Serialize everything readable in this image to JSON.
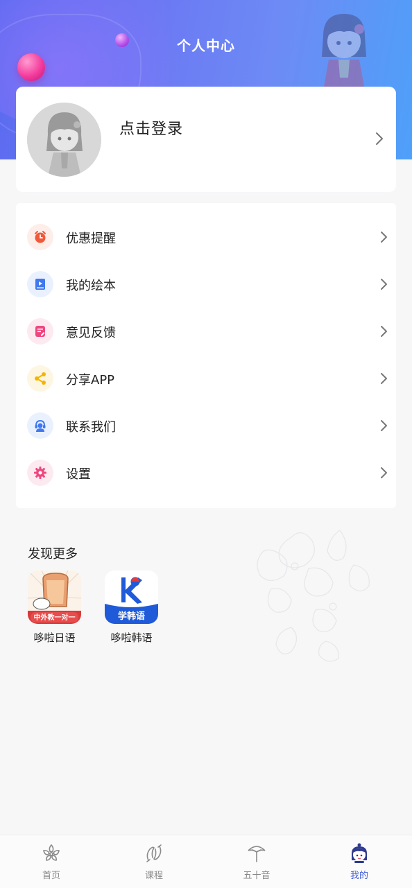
{
  "header": {
    "title": "个人中心"
  },
  "login": {
    "label": "点击登录"
  },
  "menu": {
    "items": [
      {
        "label": "优惠提醒",
        "icon": "alarm-clock-icon",
        "color": "#f05a3a",
        "bg": "#fdeeea"
      },
      {
        "label": "我的绘本",
        "icon": "picture-book-icon",
        "color": "#3f78f0",
        "bg": "#eaf1fe"
      },
      {
        "label": "意见反馈",
        "icon": "feedback-icon",
        "color": "#f0467f",
        "bg": "#fdeaf1"
      },
      {
        "label": "分享APP",
        "icon": "share-icon",
        "color": "#f5b400",
        "bg": "#fdf6e2"
      },
      {
        "label": "联系我们",
        "icon": "customer-service-icon",
        "color": "#3f78f0",
        "bg": "#eaf1fe"
      },
      {
        "label": "设置",
        "icon": "settings-gear-icon",
        "color": "#f0467f",
        "bg": "#fdeaf1"
      }
    ]
  },
  "discover": {
    "title": "发现更多",
    "apps": [
      {
        "name": "哆啦日语",
        "icon": "japanese-app-icon",
        "badge": "中外教一对一"
      },
      {
        "name": "哆啦韩语",
        "icon": "korean-app-icon",
        "badge": "学韩语"
      }
    ]
  },
  "tabbar": {
    "tabs": [
      {
        "label": "首页",
        "icon": "flower-icon",
        "active": false
      },
      {
        "label": "课程",
        "icon": "koi-fish-icon",
        "active": false
      },
      {
        "label": "五十音",
        "icon": "umbrella-icon",
        "active": false
      },
      {
        "label": "我的",
        "icon": "girl-face-icon",
        "active": true
      }
    ],
    "active_color": "#4460d8",
    "inactive_color": "#888888"
  },
  "colors": {
    "header_gradient_start": "#5a6af0",
    "header_gradient_end": "#4ea0f9",
    "page_background": "#f7f7f8"
  }
}
